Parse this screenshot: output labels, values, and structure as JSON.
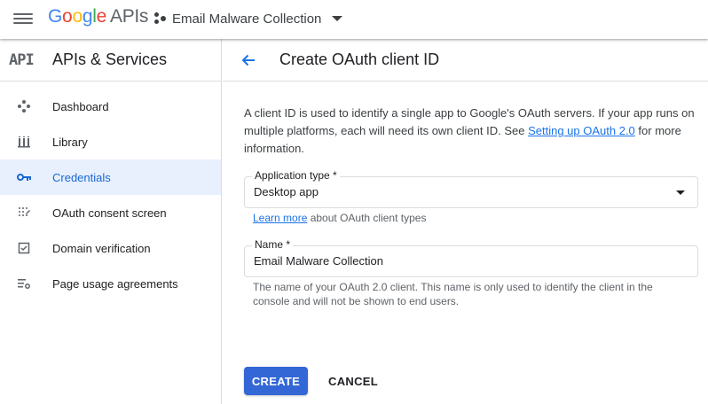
{
  "topbar": {
    "logo_google": [
      "G",
      "o",
      "o",
      "g",
      "l",
      "e"
    ],
    "logo_apis": "APIs",
    "project_name": "Email Malware Collection"
  },
  "sidebar": {
    "badge": "API",
    "title": "APIs & Services",
    "items": [
      {
        "label": "Dashboard",
        "icon": "dashboard-icon"
      },
      {
        "label": "Library",
        "icon": "library-icon"
      },
      {
        "label": "Credentials",
        "icon": "key-icon",
        "active": true
      },
      {
        "label": "OAuth consent screen",
        "icon": "consent-icon"
      },
      {
        "label": "Domain verification",
        "icon": "checkbox-icon"
      },
      {
        "label": "Page usage agreements",
        "icon": "settings-list-icon"
      }
    ]
  },
  "main": {
    "title": "Create OAuth client ID",
    "intro_text": "A client ID is used to identify a single app to Google's OAuth servers. If your app runs on multiple platforms, each will need its own client ID. See ",
    "intro_link": "Setting up OAuth 2.0",
    "intro_tail": " for more information.",
    "app_type": {
      "label": "Application type *",
      "value": "Desktop app",
      "hint_link": "Learn more",
      "hint_text": " about OAuth client types"
    },
    "name": {
      "label": "Name *",
      "value": "Email Malware Collection",
      "hint": "The name of your OAuth 2.0 client. This name is only used to identify the client in the console and will not be shown to end users."
    },
    "create_label": "CREATE",
    "cancel_label": "CANCEL"
  },
  "colors": {
    "accent": "#1a73e8",
    "active_bg": "#e8f0fe",
    "create_button": "#3367d6"
  }
}
